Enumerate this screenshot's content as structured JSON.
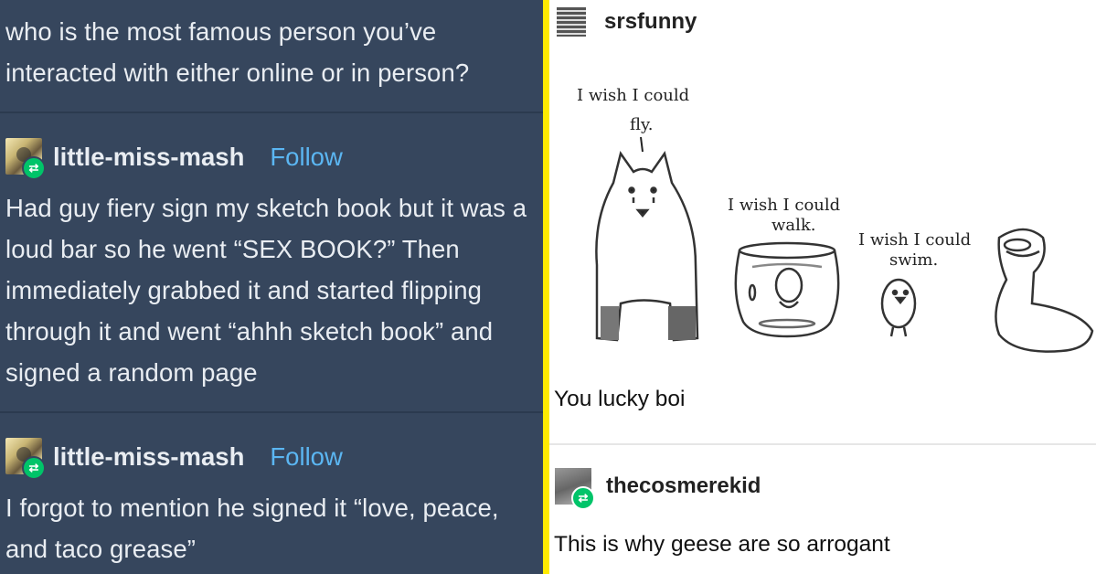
{
  "left_panel": {
    "question": "who is the most famous person you’ve interacted with either online or in person?",
    "posts": [
      {
        "username": "little-miss-mash",
        "follow_label": "Follow",
        "body": "Had guy fiery sign my sketch book but it was a loud bar so he went “SEX BOOK?” Then immediately grabbed it and started flipping through it and went “ahhh sketch book” and signed a random page"
      },
      {
        "username": "little-miss-mash",
        "follow_label": "Follow",
        "body": "I forgot to mention he signed it “love, peace, and taco grease”"
      }
    ],
    "reblog_icon": "⇄"
  },
  "right_panel": {
    "post1": {
      "username": "srsfunny",
      "comic_text": {
        "dog": "I wish I could fly.",
        "fish": "I wish I could walk.",
        "chick": "I wish I could swim.",
        "dog_line1": "I wish I could",
        "dog_line2": "fly.",
        "fish_line1": "I wish I could",
        "fish_line2": "walk.",
        "chick_line1": "I wish I could",
        "chick_line2": "swim."
      },
      "caption": "You lucky boi"
    },
    "post2": {
      "username": "thecosmerekid",
      "caption": "This is why geese are so arrogant"
    }
  },
  "colors": {
    "tumblr_bg": "#36465d",
    "follow_blue": "#5bb6f2",
    "border_yellow": "#ffeb00",
    "reblog_green": "#00c469"
  }
}
